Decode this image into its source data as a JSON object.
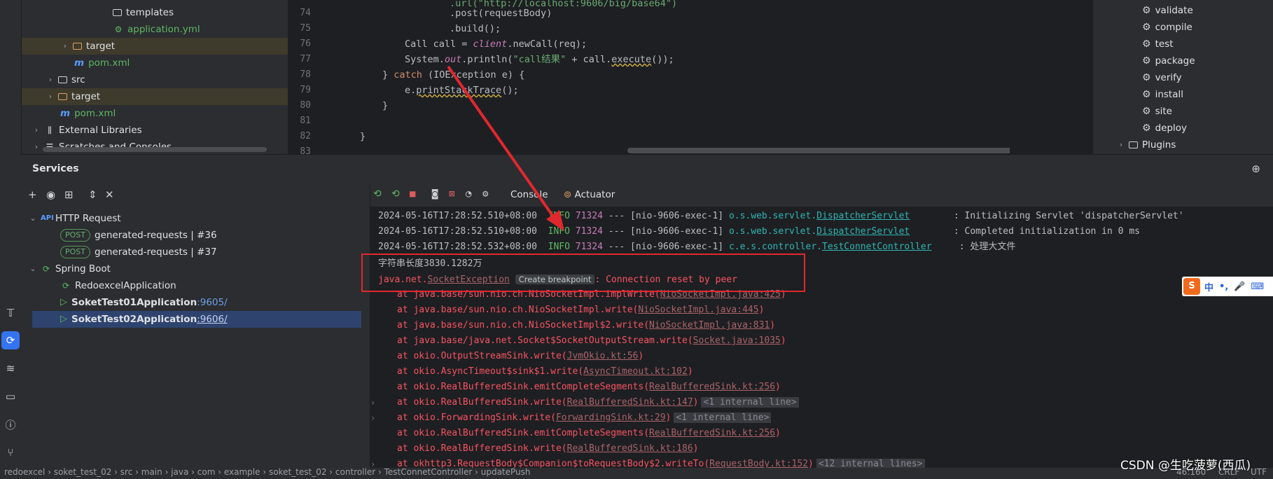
{
  "project_tree": [
    {
      "label": "templates",
      "kind": "folder"
    },
    {
      "label": "application.yml",
      "kind": "yml"
    },
    {
      "label": "target",
      "kind": "folder-orange"
    },
    {
      "label": "pom.xml",
      "kind": "maven"
    },
    {
      "label": "src",
      "kind": "folder"
    },
    {
      "label": "target",
      "kind": "folder-orange"
    },
    {
      "label": "pom.xml",
      "kind": "maven"
    },
    {
      "label": "External Libraries",
      "kind": "lib"
    },
    {
      "label": "Scratches and Consoles",
      "kind": "scratch"
    }
  ],
  "editor": {
    "line_numbers": [
      "74",
      "75",
      "76",
      "77",
      "78",
      "79",
      "80",
      "81",
      "82",
      "83"
    ],
    "lines": {
      "l74_a": ".post(",
      "l74_b": "requestBody",
      "l74_c": ")",
      "l75": ".build();",
      "l76_a": "Call call = ",
      "l76_b": "client",
      "l76_c": ".newCall(req);",
      "l77_a": "System.",
      "l77_b": "out",
      "l77_c": ".println(",
      "l77_d": "\"call结果\"",
      "l77_e": " + call.",
      "l77_f": "execute",
      "l77_g": "());",
      "l78_a": "} ",
      "l78_b": "catch",
      "l78_c": " (IOException e) {",
      "l79_a": "e.",
      "l79_b": "printStackTrace",
      "l79_c": "();",
      "l80": "}",
      "l82": "}"
    }
  },
  "maven": [
    {
      "label": "validate"
    },
    {
      "label": "compile"
    },
    {
      "label": "test"
    },
    {
      "label": "package"
    },
    {
      "label": "verify"
    },
    {
      "label": "install"
    },
    {
      "label": "site"
    },
    {
      "label": "deploy"
    },
    {
      "label": "Plugins"
    }
  ],
  "services": {
    "title": "Services",
    "http_request": "HTTP Request",
    "requests": [
      {
        "method": "POST",
        "name": "generated-requests",
        "num": "|  #36"
      },
      {
        "method": "POST",
        "name": "generated-requests",
        "num": "|  #37"
      }
    ],
    "spring_boot": "Spring Boot",
    "apps": [
      {
        "name": "RedoexcelApplication",
        "port": ""
      },
      {
        "name": "SoketTest01Application",
        "port": ":9605/"
      },
      {
        "name": "SoketTest02Application",
        "port": ":9606/"
      }
    ]
  },
  "console": {
    "tabs": [
      "Console",
      "Actuator"
    ],
    "logs": [
      {
        "ts": "2024-05-16T17:28:52.510+08:00",
        "level": "INFO",
        "pid": "71324",
        "thread": " --- [nio-9606-exec-1] ",
        "pkg": "o.s.web.servlet.",
        "cls": "DispatcherServlet",
        "pad": "        ",
        "msg": ": Initializing Servlet 'dispatcherServlet'"
      },
      {
        "ts": "2024-05-16T17:28:52.510+08:00",
        "level": "INFO",
        "pid": "71324",
        "thread": " --- [nio-9606-exec-1] ",
        "pkg": "o.s.web.servlet.",
        "cls": "DispatcherServlet",
        "pad": "        ",
        "msg": ": Completed initialization in 0 ms"
      },
      {
        "ts": "2024-05-16T17:28:52.532+08:00",
        "level": "INFO",
        "pid": "71324",
        "thread": " --- [nio-9606-exec-1] ",
        "pkg": "c.e.s.controller.",
        "cls": "TestConnetController",
        "pad": "     ",
        "msg": ": 处理大文件"
      }
    ],
    "output_line": "字符串长度3830.1282万",
    "exception_pkg": "java.net.",
    "exception_cls": "SocketException",
    "breakpoint_tooltip": "Create breakpoint",
    "exception_msg": ": Connection reset by peer",
    "stack": [
      {
        "at": "at java.base/sun.nio.ch.NioSocketImpl.implWrite(",
        "src": "NioSocketImpl.java:425",
        "tail": ")",
        "internal": "",
        "fold": false
      },
      {
        "at": "at java.base/sun.nio.ch.NioSocketImpl.write(",
        "src": "NioSocketImpl.java:445",
        "tail": ")",
        "internal": "",
        "fold": false
      },
      {
        "at": "at java.base/sun.nio.ch.NioSocketImpl$2.write(",
        "src": "NioSocketImpl.java:831",
        "tail": ")",
        "internal": "",
        "fold": false
      },
      {
        "at": "at java.base/java.net.Socket$SocketOutputStream.write(",
        "src": "Socket.java:1035",
        "tail": ")",
        "internal": "",
        "fold": false
      },
      {
        "at": "at okio.OutputStreamSink.write(",
        "src": "JvmOkio.kt:56",
        "tail": ")",
        "internal": "",
        "fold": false
      },
      {
        "at": "at okio.AsyncTimeout$sink$1.write(",
        "src": "AsyncTimeout.kt:102",
        "tail": ")",
        "internal": "",
        "fold": false
      },
      {
        "at": "at okio.RealBufferedSink.emitCompleteSegments(",
        "src": "RealBufferedSink.kt:256",
        "tail": ")",
        "internal": "",
        "fold": false
      },
      {
        "at": "at okio.RealBufferedSink.write(",
        "src": "RealBufferedSink.kt:147",
        "tail": ")",
        "internal": "<1 internal line>",
        "fold": true
      },
      {
        "at": "at okio.ForwardingSink.write(",
        "src": "ForwardingSink.kt:29",
        "tail": ")",
        "internal": "<1 internal line>",
        "fold": true
      },
      {
        "at": "at okio.RealBufferedSink.emitCompleteSegments(",
        "src": "RealBufferedSink.kt:256",
        "tail": ")",
        "internal": "",
        "fold": false
      },
      {
        "at": "at okio.RealBufferedSink.write(",
        "src": "RealBufferedSink.kt:186",
        "tail": ")",
        "internal": "",
        "fold": false
      },
      {
        "at": "at okhttp3.RequestBody$Companion$toRequestBody$2.writeTo(",
        "src": "RequestBody.kt:152",
        "tail": ")",
        "internal": "<12 internal lines>",
        "fold": true
      }
    ]
  },
  "ime": {
    "logo": "S",
    "lang": "中",
    "punct": "•,"
  },
  "status_bar": {
    "breadcrumbs": [
      "redoexcel",
      "soket_test_02",
      "src",
      "main",
      "java",
      "com",
      "example",
      "soket_test_02",
      "controller",
      "TestConnetController",
      "updatePush"
    ],
    "position": "46:160",
    "line_sep": "CRLF",
    "encoding": "UTF"
  },
  "watermark": "CSDN @生吃菠萝(西瓜)",
  "colors": {
    "accent": "#3574f0",
    "error": "#f75464",
    "annotation": "#e0282e"
  }
}
